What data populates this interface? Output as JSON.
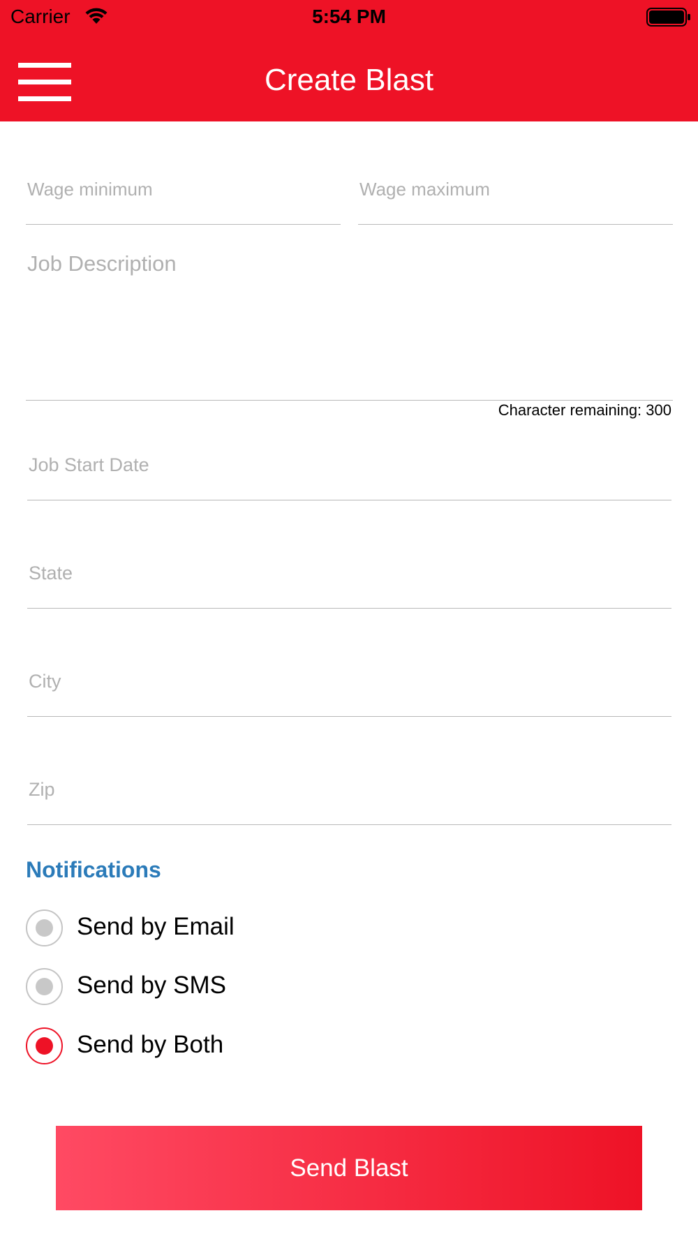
{
  "status_bar": {
    "carrier": "Carrier",
    "time": "5:54 PM",
    "wifi_icon": "wifi-icon",
    "battery_icon": "battery-icon"
  },
  "nav": {
    "title": "Create Blast",
    "menu_icon": "hamburger-menu-icon",
    "background_color": "#EE1226"
  },
  "form": {
    "wage_min_placeholder": "Wage minimum",
    "wage_max_placeholder": "Wage maximum",
    "job_description_placeholder": "Job Description",
    "character_remaining": "Character remaining: 300",
    "job_start_date_placeholder": "Job Start Date",
    "state_placeholder": "State",
    "city_placeholder": "City",
    "zip_placeholder": "Zip"
  },
  "notifications": {
    "heading": "Notifications",
    "heading_color": "#2B7BB9",
    "options": [
      {
        "label": "Send by Email",
        "selected": false
      },
      {
        "label": "Send by SMS",
        "selected": false
      },
      {
        "label": "Send by Both",
        "selected": true
      }
    ]
  },
  "actions": {
    "send_label": "Send Blast",
    "gradient_start": "#FF4A63",
    "gradient_end": "#EE1226"
  }
}
